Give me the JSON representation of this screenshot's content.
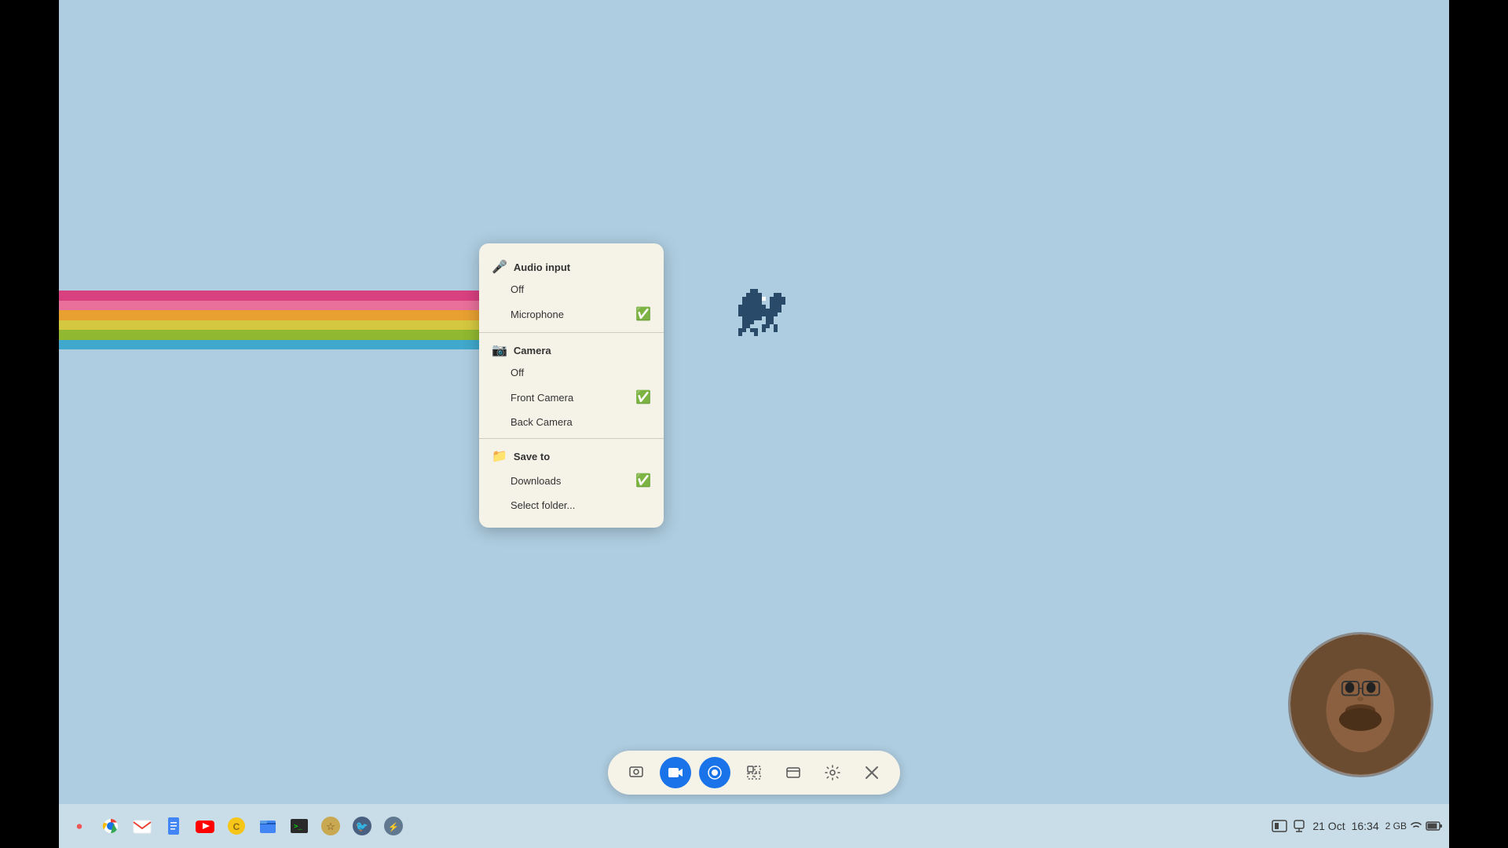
{
  "desktop": {
    "bg_color": "#aecde0"
  },
  "rainbow": {
    "stripes": [
      "#e05090",
      "#e8709a",
      "#f0a030",
      "#d8c840",
      "#a0c840",
      "#50b8d0"
    ]
  },
  "popup_menu": {
    "sections": [
      {
        "id": "audio_input",
        "icon": "🎤",
        "header": "Audio input",
        "items": [
          {
            "label": "Off",
            "checked": false
          },
          {
            "label": "Microphone",
            "checked": true
          }
        ]
      },
      {
        "id": "camera",
        "icon": "📷",
        "header": "Camera",
        "items": [
          {
            "label": "Off",
            "checked": false
          },
          {
            "label": "Front Camera",
            "checked": true
          },
          {
            "label": "Back Camera",
            "checked": false
          }
        ]
      },
      {
        "id": "save_to",
        "icon": "📁",
        "header": "Save to",
        "items": [
          {
            "label": "Downloads",
            "checked": true
          },
          {
            "label": "Select folder...",
            "checked": false
          }
        ]
      }
    ]
  },
  "toolbar": {
    "buttons": [
      {
        "id": "screenshot",
        "icon": "📷",
        "active": false,
        "label": "Screenshot"
      },
      {
        "id": "record",
        "icon": "⏺",
        "active": true,
        "label": "Record"
      },
      {
        "id": "fullscreen",
        "icon": "⊙",
        "active": false,
        "label": "Fullscreen capture"
      },
      {
        "id": "partial",
        "icon": "⊞",
        "active": false,
        "label": "Partial capture"
      },
      {
        "id": "window",
        "icon": "▭",
        "active": false,
        "label": "Window capture"
      },
      {
        "id": "settings",
        "icon": "⚙",
        "active": false,
        "label": "Settings"
      },
      {
        "id": "close",
        "icon": "✕",
        "active": false,
        "label": "Close"
      }
    ]
  },
  "taskbar": {
    "apps": [
      {
        "id": "record-dot",
        "icon": "⏺",
        "label": "Recording indicator"
      },
      {
        "id": "chrome",
        "label": "Chrome",
        "color": "#4285f4"
      },
      {
        "id": "gmail",
        "label": "Gmail",
        "color": "#ea4335"
      },
      {
        "id": "docs",
        "label": "Google Docs",
        "color": "#4285f4"
      },
      {
        "id": "youtube",
        "label": "YouTube",
        "color": "#ff0000"
      },
      {
        "id": "extensions",
        "label": "Extensions",
        "color": "#f5c518"
      },
      {
        "id": "files",
        "label": "Files",
        "color": "#4285f4"
      },
      {
        "id": "terminal",
        "label": "Terminal",
        "color": "#333"
      },
      {
        "id": "app6",
        "label": "App",
        "color": "#888"
      },
      {
        "id": "app7",
        "label": "App",
        "color": "#888"
      },
      {
        "id": "app8",
        "label": "App",
        "color": "#888"
      }
    ],
    "system": {
      "date": "21 Oct",
      "time": "16:34",
      "battery": "2 GB",
      "wifi": "WiFi"
    }
  }
}
